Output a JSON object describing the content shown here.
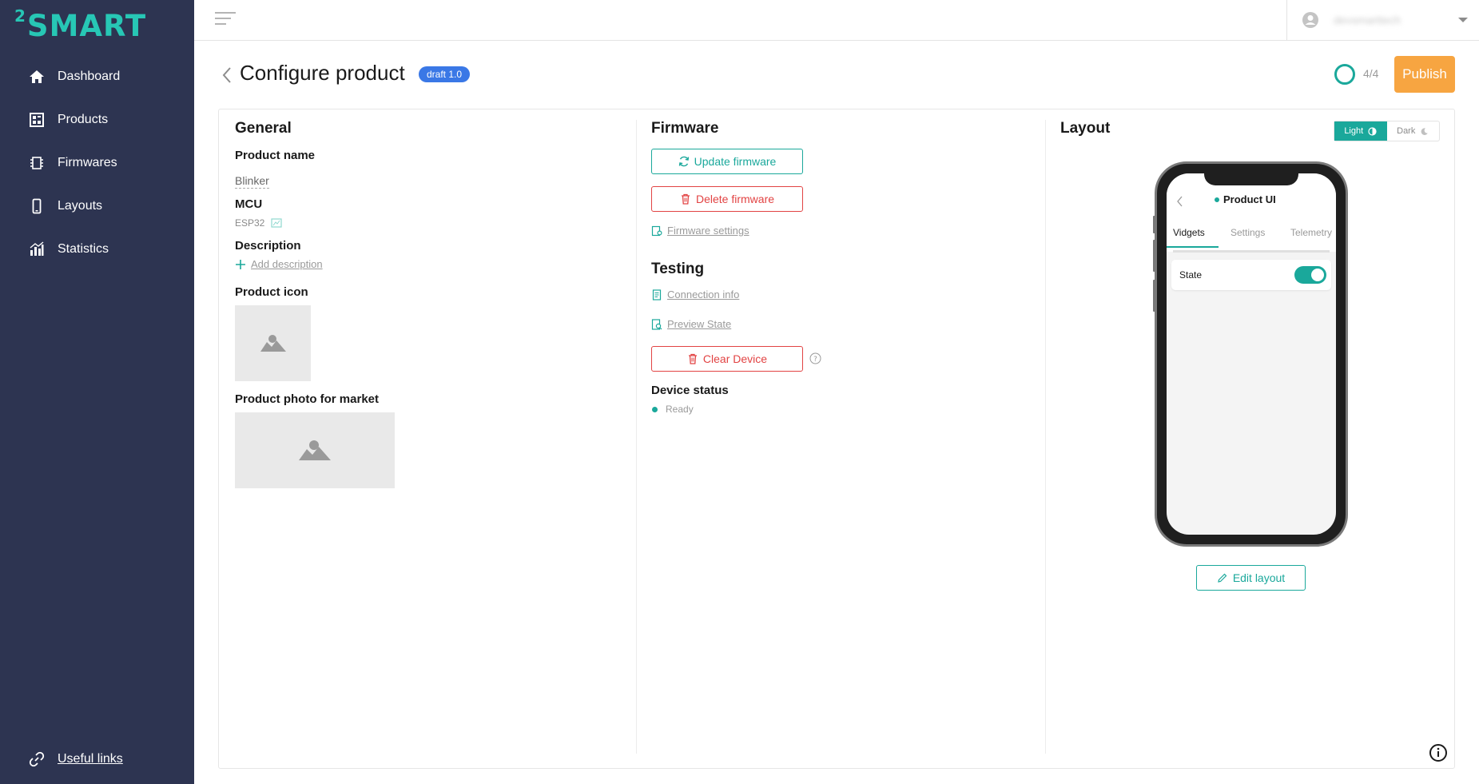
{
  "sidebar": {
    "logo": "SMART",
    "logo_sup": "2",
    "items": [
      {
        "label": "Dashboard",
        "icon": "home-icon"
      },
      {
        "label": "Products",
        "icon": "products-icon"
      },
      {
        "label": "Firmwares",
        "icon": "chip-icon"
      },
      {
        "label": "Layouts",
        "icon": "phone-icon"
      },
      {
        "label": "Statistics",
        "icon": "chart-icon"
      }
    ],
    "useful_links": "Useful links"
  },
  "topbar": {
    "username": "devsmarttech"
  },
  "header": {
    "title": "Configure product",
    "draft_badge": "draft 1.0",
    "progress": "4/4",
    "publish_label": "Publish"
  },
  "general": {
    "title": "General",
    "product_name_label": "Product name",
    "product_name_value": "Blinker",
    "mcu_label": "MCU",
    "mcu_value": "ESP32",
    "description_label": "Description",
    "add_description": "Add description",
    "product_icon_label": "Product icon",
    "product_photo_label": "Product photo for market"
  },
  "firmware": {
    "title": "Firmware",
    "update_label": "Update firmware",
    "delete_label": "Delete firmware",
    "settings_label": "Firmware settings"
  },
  "testing": {
    "title": "Testing",
    "connection_info": "Connection info",
    "preview_state": "Preview State",
    "clear_device": "Clear Device",
    "device_status_label": "Device status",
    "device_status_value": "Ready"
  },
  "layout": {
    "title": "Layout",
    "theme_light": "Light",
    "theme_dark": "Dark",
    "theme_selected": "Light",
    "edit_layout": "Edit layout",
    "phone": {
      "title": "Product UI",
      "tabs": [
        "Vidgets",
        "Settings",
        "Telemetry"
      ],
      "active_tab": "Vidgets",
      "widget_label": "State",
      "widget_on": true
    }
  },
  "colors": {
    "sidebar_bg": "#2d3451",
    "accent": "#1aa89b",
    "publish": "#f7a541",
    "danger": "#e24343",
    "badge": "#3a78e6"
  }
}
